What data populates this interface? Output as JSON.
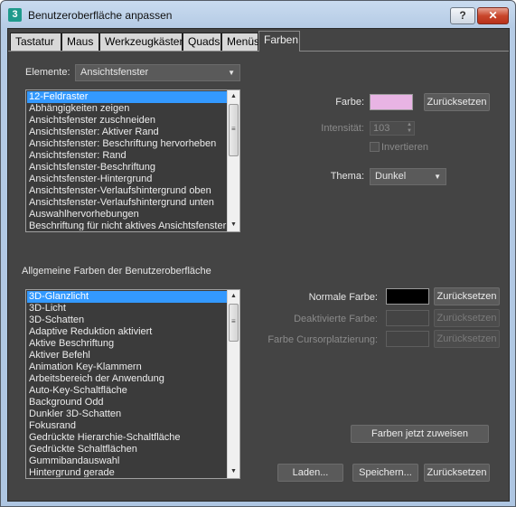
{
  "window": {
    "title": "Benutzeroberfläche anpassen",
    "app_icon_text": "3",
    "help_label": "?",
    "close_label": "✕"
  },
  "tabs": [
    {
      "label": "Tastatur"
    },
    {
      "label": "Maus"
    },
    {
      "label": "Werkzeugkästen"
    },
    {
      "label": "Quads"
    },
    {
      "label": "Menüs"
    },
    {
      "label": "Farben",
      "active": true
    }
  ],
  "elements": {
    "label": "Elemente:",
    "selected": "Ansichtsfenster",
    "items": [
      "12-Feldraster",
      "Abhängigkeiten zeigen",
      "Ansichtsfenster zuschneiden",
      "Ansichtsfenster: Aktiver Rand",
      "Ansichtsfenster: Beschriftung hervorheben",
      "Ansichtsfenster: Rand",
      "Ansichtsfenster-Beschriftung",
      "Ansichtsfenster-Hintergrund",
      "Ansichtsfenster-Verlaufshintergrund oben",
      "Ansichtsfenster-Verlaufshintergrund unten",
      "Auswahlhervorhebungen",
      "Beschriftung für nicht aktives Ansichtsfenster"
    ],
    "selected_index": 0
  },
  "color_panel": {
    "farbe_label": "Farbe:",
    "farbe_color": "#e8b4e4",
    "reset_label": "Zurücksetzen",
    "intensity_label": "Intensität:",
    "intensity_value": "103",
    "invert_label": "Invertieren",
    "theme_label": "Thema:",
    "theme_value": "Dunkel"
  },
  "ui_colors": {
    "label": "Allgemeine Farben der Benutzeroberfläche",
    "items": [
      "3D-Glanzlicht",
      "3D-Licht",
      "3D-Schatten",
      "Adaptive Reduktion aktiviert",
      "Aktive Beschriftung",
      "Aktiver Befehl",
      "Animation Key-Klammern",
      "Arbeitsbereich der Anwendung",
      "Auto-Key-Schaltfläche",
      "Background Odd",
      "Dunkler 3D-Schatten",
      "Fokusrand",
      "Gedrückte Hierarchie-Schaltfläche",
      "Gedrückte Schaltflächen",
      "Gummibandauswahl",
      "Hintergrund gerade"
    ],
    "selected_index": 0
  },
  "ui_color_panel": {
    "normal_label": "Normale Farbe:",
    "normal_color": "#000000",
    "disabled_label": "Deaktivierte Farbe:",
    "cursor_label": "Farbe Cursorplatzierung:",
    "reset_label": "Zurücksetzen"
  },
  "footer": {
    "apply_label": "Farben jetzt zuweisen",
    "load_label": "Laden...",
    "save_label": "Speichern...",
    "reset_label": "Zurücksetzen"
  }
}
